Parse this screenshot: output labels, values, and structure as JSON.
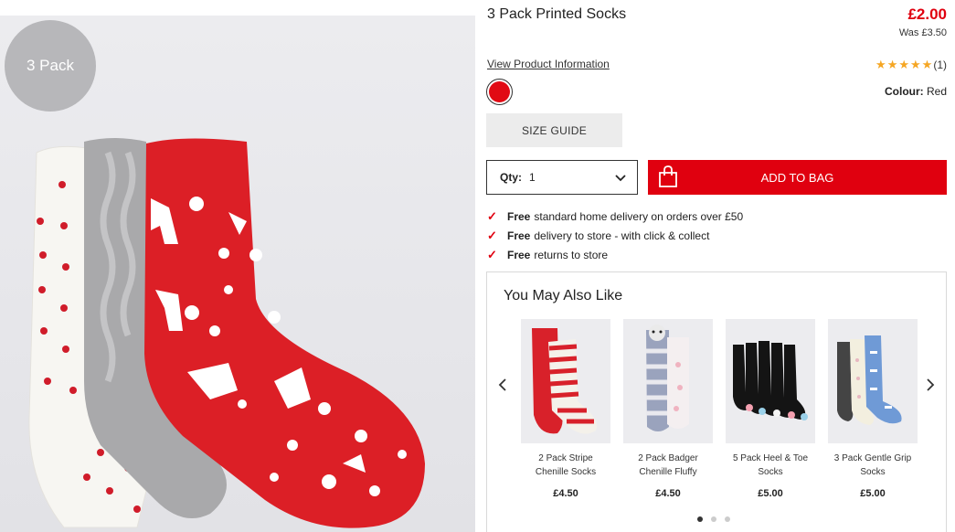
{
  "product": {
    "badge": "3 Pack",
    "title": "3 Pack Printed Socks",
    "price": "£2.00",
    "was_price": "Was £3.50",
    "view_info": "View Product Information",
    "rating_count": "(1)",
    "rating_stars": 5,
    "colour_label": "Colour:",
    "colour_value": "Red",
    "swatch_color": "#e10a14"
  },
  "actions": {
    "size_guide": "SIZE GUIDE",
    "qty_label": "Qty:",
    "qty_value": "1",
    "add_to_bag": "ADD TO BAG"
  },
  "benefits": [
    {
      "bold": "Free",
      "text": "standard home delivery on orders over £50"
    },
    {
      "bold": "Free",
      "text": "delivery to store - with click & collect"
    },
    {
      "bold": "Free",
      "text": "returns to store"
    }
  ],
  "recommendations": {
    "title": "You May Also Like",
    "items": [
      {
        "name": "2 Pack Stripe Chenille Socks",
        "price": "£4.50"
      },
      {
        "name": "2 Pack Badger Chenille Fluffy",
        "price": "£4.50"
      },
      {
        "name": "5 Pack Heel & Toe Socks",
        "price": "£5.00"
      },
      {
        "name": "3 Pack Gentle Grip Socks",
        "price": "£5.00"
      }
    ],
    "pages": 3,
    "active_page": 1
  },
  "colors": {
    "brand_red": "#e0000f",
    "star": "#f5a623"
  }
}
